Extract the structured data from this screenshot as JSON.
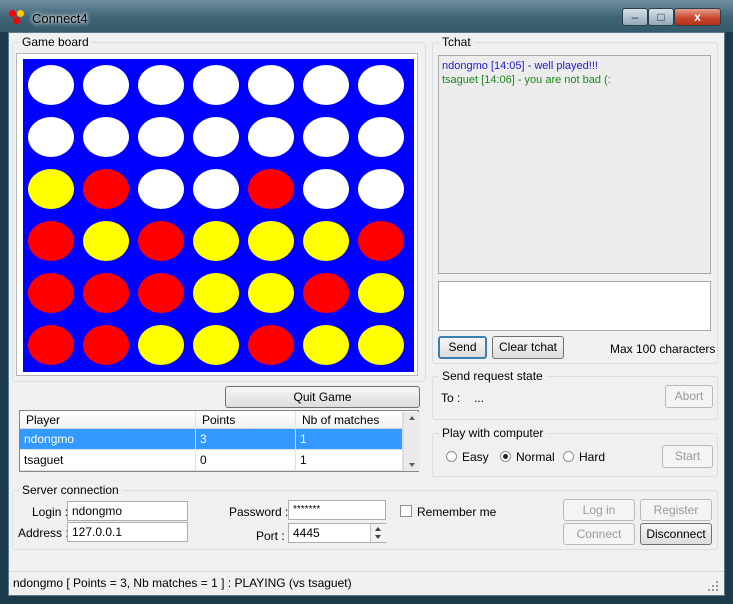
{
  "window": {
    "title": "Connect4",
    "minimize": "–",
    "maximize": "□",
    "close": "x"
  },
  "game_board": {
    "title": "Game board",
    "colors": {
      "board": "#0000ff",
      "empty": "#ffffff",
      "red": "#ff0000",
      "yellow": "#ffff00"
    },
    "rows": [
      [
        "empty",
        "empty",
        "empty",
        "empty",
        "empty",
        "empty",
        "empty"
      ],
      [
        "empty",
        "empty",
        "empty",
        "empty",
        "empty",
        "empty",
        "empty"
      ],
      [
        "yellow",
        "red",
        "empty",
        "empty",
        "red",
        "empty",
        "empty"
      ],
      [
        "red",
        "yellow",
        "red",
        "yellow",
        "yellow",
        "yellow",
        "red"
      ],
      [
        "red",
        "red",
        "red",
        "yellow",
        "yellow",
        "red",
        "yellow"
      ],
      [
        "red",
        "red",
        "yellow",
        "yellow",
        "red",
        "yellow",
        "yellow"
      ]
    ],
    "quit_label": "Quit Game"
  },
  "players_table": {
    "headers": [
      "Player",
      "Points",
      "Nb of matches"
    ],
    "rows": [
      {
        "player": "ndongmo",
        "points": "3",
        "matches": "1",
        "selected": true
      },
      {
        "player": "tsaguet",
        "points": "0",
        "matches": "1",
        "selected": false
      }
    ]
  },
  "tchat": {
    "title": "Tchat",
    "messages": [
      {
        "text": "ndongmo [14:05] - well played!!!",
        "color": "#2020d0"
      },
      {
        "text": "tsaguet [14:06] - you are not bad (:",
        "color": "#1a8a1a"
      }
    ],
    "input_value": "",
    "send_label": "Send",
    "clear_label": "Clear tchat",
    "max_label": "Max 100 characters"
  },
  "send_request": {
    "title": "Send request state",
    "to_label": "To :",
    "to_value": "...",
    "abort_label": "Abort"
  },
  "play_computer": {
    "title": "Play with computer",
    "options": [
      {
        "label": "Easy",
        "selected": false
      },
      {
        "label": "Normal",
        "selected": true
      },
      {
        "label": "Hard",
        "selected": false
      }
    ],
    "start_label": "Start"
  },
  "server": {
    "title": "Server connection",
    "login_label": "Login :",
    "login_value": "ndongmo",
    "password_label": "Password :",
    "password_value": "*******",
    "remember_label": "Remember me",
    "remember_checked": false,
    "address_label": "Address :",
    "address_value": "127.0.0.1",
    "port_label": "Port :",
    "port_value": "4445",
    "login_btn": "Log in",
    "register_btn": "Register",
    "connect_btn": "Connect",
    "disconnect_btn": "Disconnect"
  },
  "status": {
    "text": "ndongmo [ Points = 3, Nb matches = 1 ] : PLAYING (vs tsaguet)"
  }
}
